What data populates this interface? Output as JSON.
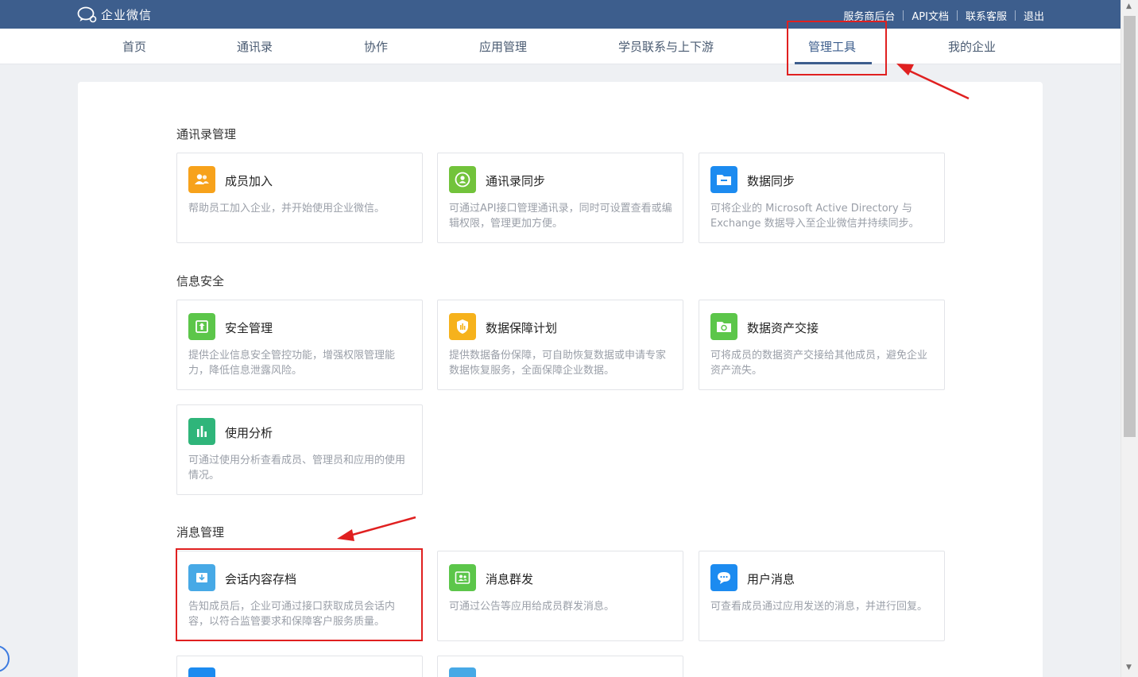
{
  "header": {
    "logo_text": "企业微信",
    "links": [
      "服务商后台",
      "API文档",
      "联系客服",
      "退出"
    ]
  },
  "nav": {
    "items": [
      "首页",
      "通讯录",
      "协作",
      "应用管理",
      "学员联系与上下游",
      "管理工具",
      "我的企业"
    ],
    "active": "管理工具"
  },
  "sections": {
    "contacts": {
      "title": "通讯录管理",
      "cards": [
        {
          "title": "成员加入",
          "desc": "帮助员工加入企业，并开始使用企业微信。",
          "icon": "members-join-icon",
          "color": "#f7a21b"
        },
        {
          "title": "通讯录同步",
          "desc": "可通过API接口管理通讯录，同时可设置查看或编辑权限，管理更加方便。",
          "icon": "contacts-sync-icon",
          "color": "#72c33b"
        },
        {
          "title": "数据同步",
          "desc": "可将企业的 Microsoft Active Directory 与 Exchange 数据导入至企业微信并持续同步。",
          "icon": "data-sync-folder-icon",
          "color": "#1c8bf0"
        }
      ]
    },
    "security": {
      "title": "信息安全",
      "cards": [
        {
          "title": "安全管理",
          "desc": "提供企业信息安全管控功能，增强权限管理能力，降低信息泄露风险。",
          "icon": "security-icon",
          "color": "#5cc64a"
        },
        {
          "title": "数据保障计划",
          "desc": "提供数据备份保障，可自助恢复数据或申请专家数据恢复服务，全面保障企业数据。",
          "icon": "shield-icon",
          "color": "#f6b21c"
        },
        {
          "title": "数据资产交接",
          "desc": "可将成员的数据资产交接给其他成员，避免企业资产流失。",
          "icon": "asset-handover-icon",
          "color": "#5cc64a"
        },
        {
          "title": "使用分析",
          "desc": "可通过使用分析查看成员、管理员和应用的使用情况。",
          "icon": "bar-chart-icon",
          "color": "#2fb57a"
        }
      ]
    },
    "messages": {
      "title": "消息管理",
      "cards": [
        {
          "title": "会话内容存档",
          "desc": "告知成员后，企业可通过接口获取成员会话内容，以符合监管要求和保障客户服务质量。",
          "icon": "archive-icon",
          "color": "#47a9e6"
        },
        {
          "title": "消息群发",
          "desc": "可通过公告等应用给成员群发消息。",
          "icon": "broadcast-icon",
          "color": "#5cc64a"
        },
        {
          "title": "用户消息",
          "desc": "可查看成员通过应用发送的消息，并进行回复。",
          "icon": "chat-bubble-icon",
          "color": "#1c8bf0"
        }
      ]
    }
  },
  "colors": {
    "header_bg": "#3d5e8d",
    "highlight": "#e02020"
  }
}
